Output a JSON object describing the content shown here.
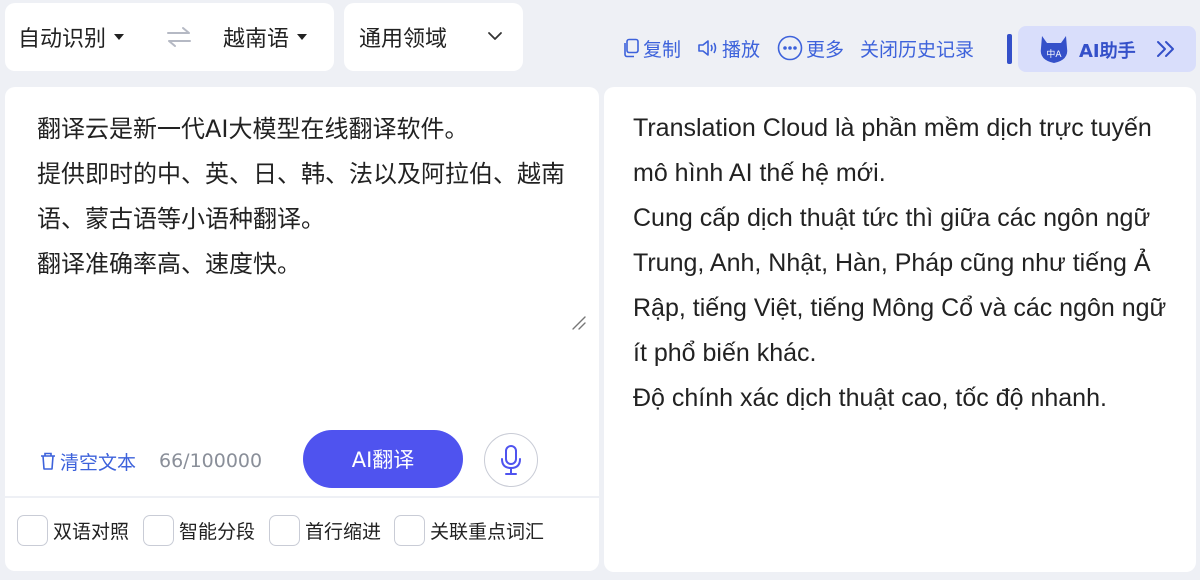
{
  "language_bar": {
    "source_language": "自动识别",
    "target_language": "越南语",
    "swap_icon": "swap-arrows-icon"
  },
  "domain": {
    "label": "通用领域"
  },
  "toolbar": {
    "copy": "复制",
    "play": "播放",
    "more": "更多",
    "history": "关闭历史记录",
    "ai_assistant": "AI助手",
    "avatar_text": "中A"
  },
  "source": {
    "text": "翻译云是新一代AI大模型在线翻译软件。\n提供即时的中、英、日、韩、法以及阿拉伯、越南语、蒙古语等小语种翻译。\n翻译准确率高、速度快。",
    "clear_label": "清空文本",
    "char_count": "66/100000",
    "translate_label": "AI翻译"
  },
  "options": [
    {
      "label": "双语对照",
      "checked": false
    },
    {
      "label": "智能分段",
      "checked": false
    },
    {
      "label": "首行缩进",
      "checked": false
    },
    {
      "label": "关联重点词汇",
      "checked": false
    }
  ],
  "target": {
    "text": "Translation Cloud là phần mềm dịch trực tuyến mô hình AI thế hệ mới.\nCung cấp dịch thuật tức thì giữa các ngôn ngữ Trung, Anh, Nhật, Hàn, Pháp cũng như tiếng Ả Rập, tiếng Việt, tiếng Mông Cổ và các ngôn ngữ ít phổ biến khác.\nĐộ chính xác dịch thuật cao, tốc độ nhanh."
  },
  "colors": {
    "accent": "#3d62db",
    "primary_button": "#4f53ef",
    "ai_pill": "#d9defb",
    "background": "#eef0f5"
  }
}
